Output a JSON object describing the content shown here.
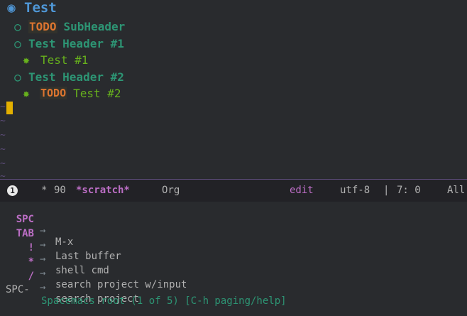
{
  "buffer": {
    "headings": [
      {
        "level": 1,
        "bullet": "◉",
        "keyword": "",
        "text": "Test"
      },
      {
        "level": 2,
        "bullet": "○",
        "keyword": "TODO",
        "text": "SubHeader"
      },
      {
        "level": 2,
        "bullet": "○",
        "keyword": "",
        "text": "Test Header #1"
      },
      {
        "level": 3,
        "bullet": "✸",
        "keyword": "",
        "text": "Test #1"
      },
      {
        "level": 2,
        "bullet": "○",
        "keyword": "",
        "text": "Test Header #2"
      },
      {
        "level": 3,
        "bullet": "✸",
        "keyword": "TODO",
        "text": "Test #2"
      }
    ],
    "fringe_glyph": "~"
  },
  "modeline": {
    "window_number": "1",
    "modified": "*",
    "size": "90",
    "buffer_name": "*scratch*",
    "major_mode": "Org",
    "evil_state": "edit",
    "encoding": "utf-8",
    "separator": "|",
    "position": "7: 0",
    "scroll": "All"
  },
  "which_key": {
    "arrow": "→",
    "bindings": [
      {
        "key": "SPC",
        "desc": "M-x"
      },
      {
        "key": "TAB",
        "desc": "Last buffer"
      },
      {
        "key": "!",
        "desc": "shell cmd"
      },
      {
        "key": "*",
        "desc": "search project w/input"
      },
      {
        "key": "/",
        "desc": "search project"
      }
    ],
    "prefix": "SPC-",
    "status": "Spacemacs root (1 of 5) [C-h paging/help]"
  },
  "colors": {
    "background": "#292b2e",
    "level1": "#4f97d7",
    "level2": "#2d9574",
    "level3": "#67b11d",
    "todo": "#dc752f",
    "key": "#bc6ec5",
    "cursor": "#e3b000",
    "status": "#2d9574"
  }
}
